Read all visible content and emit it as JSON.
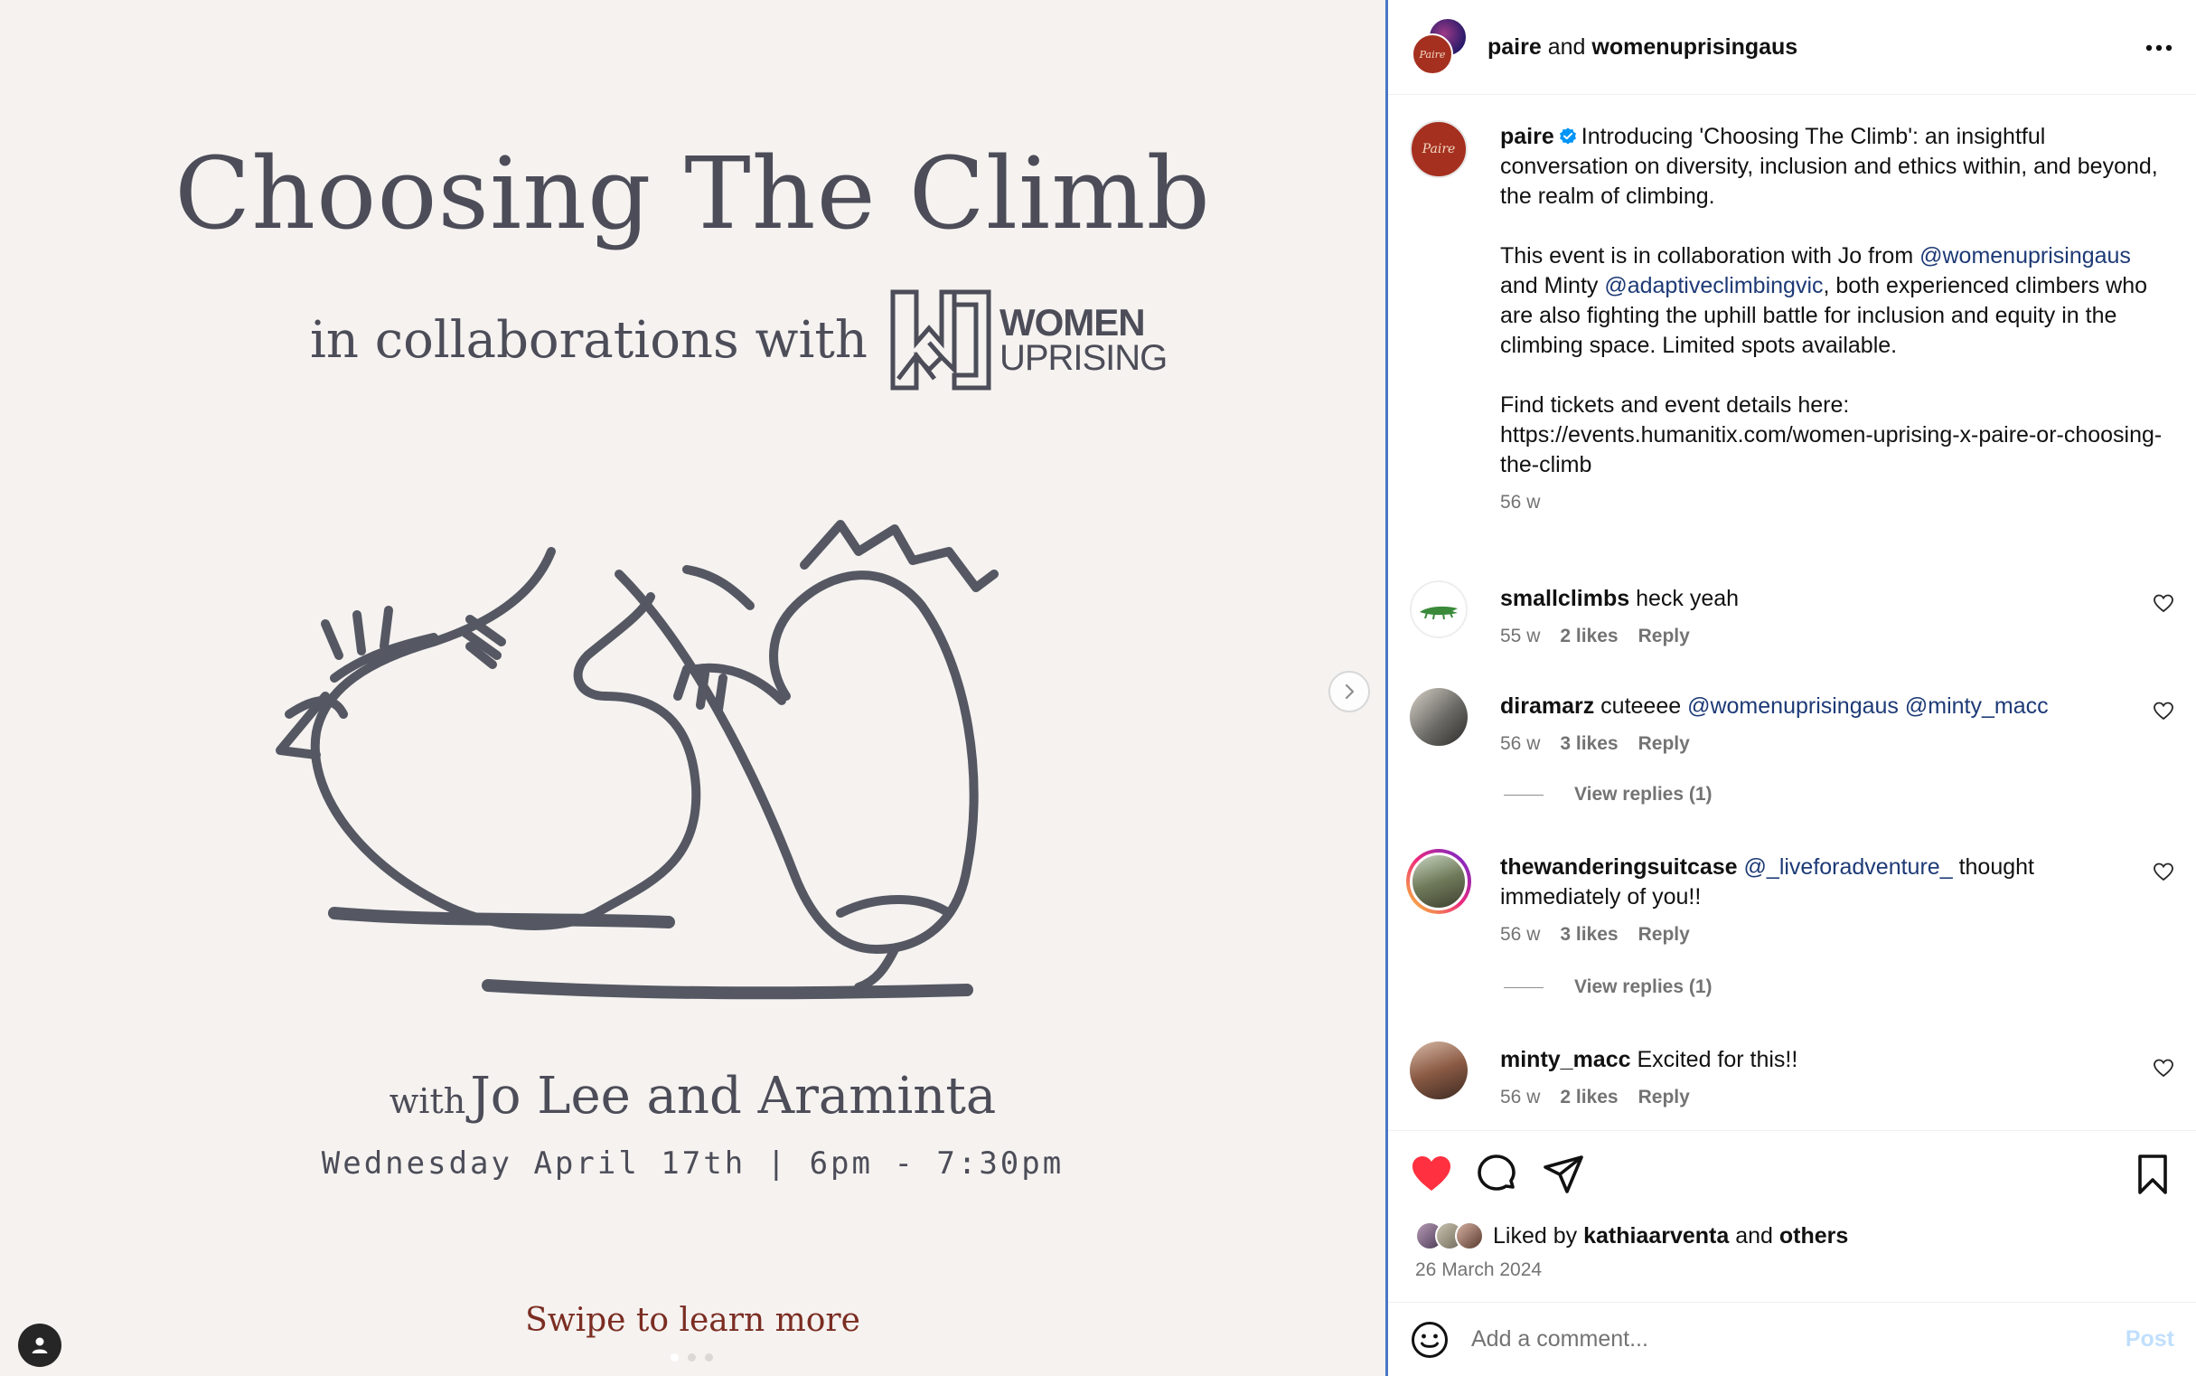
{
  "media": {
    "title": "Choosing The Climb",
    "collab_text": "in collaborations with",
    "logo_word_1": "WOMEN",
    "logo_word_2": "UPRISING",
    "hosts_prefix": "with",
    "hosts_names": "Jo Lee and Araminta",
    "event_date": "Wednesday April 17th | 6pm - 7:30pm",
    "swipe_text": "Swipe to learn more",
    "carousel": {
      "slides": 3,
      "active_index": 0
    },
    "next_icon": "chevron-right-icon",
    "tagged_icon": "user-icon"
  },
  "header": {
    "user_1": "paire",
    "joiner": "and",
    "user_2": "womenuprisingaus",
    "more_icon": "more-horizontal-icon"
  },
  "caption": {
    "username": "paire",
    "verified": true,
    "para_1": "Introducing 'Choosing The Climb': an insightful conversation on diversity, inclusion and ethics within, and beyond, the realm of climbing.",
    "para_2_a": "This event is in collaboration with Jo from",
    "para_2_mention_1": "@womenuprisingaus",
    "para_2_b": "and Minty",
    "para_2_mention_2": "@adaptiveclimbingvic",
    "para_2_c": ", both experienced climbers who are also fighting the uphill battle for inclusion and equity in the climbing space. Limited spots available.",
    "para_3_a": "Find tickets and event details here:",
    "para_3_url": "https://events.humanitix.com/women-uprising-x-paire-or-choosing-the-climb",
    "time": "56 w"
  },
  "comments": [
    {
      "username": "smallclimbs",
      "text": "heck yeah",
      "mentions": "",
      "text_after": "",
      "time": "55 w",
      "likes": "2 likes",
      "reply": "Reply",
      "view_replies": ""
    },
    {
      "username": "diramarz",
      "text": "cuteeee",
      "mentions": "@womenuprisingaus @minty_macc",
      "text_after": "",
      "time": "56 w",
      "likes": "3 likes",
      "reply": "Reply",
      "view_replies": "View replies (1)"
    },
    {
      "username": "thewanderingsuitcase",
      "text": "",
      "mentions": "@_liveforadventure_",
      "text_after": "thought immediately of you!!",
      "time": "56 w",
      "likes": "3 likes",
      "reply": "Reply",
      "view_replies": "View replies (1)"
    },
    {
      "username": "minty_macc",
      "text": "Excited for this!!",
      "mentions": "",
      "text_after": "",
      "time": "56 w",
      "likes": "2 likes",
      "reply": "Reply",
      "view_replies": ""
    }
  ],
  "actions": {
    "liked": true,
    "like_color": "#ff3040",
    "liked_prefix": "Liked by",
    "liked_user": "kathiaarventa",
    "liked_joiner": "and",
    "liked_others": "others",
    "post_date": "26 March 2024"
  },
  "comment_bar": {
    "placeholder": "Add a comment...",
    "post_label": "Post",
    "post_color": "#c0dffd"
  }
}
